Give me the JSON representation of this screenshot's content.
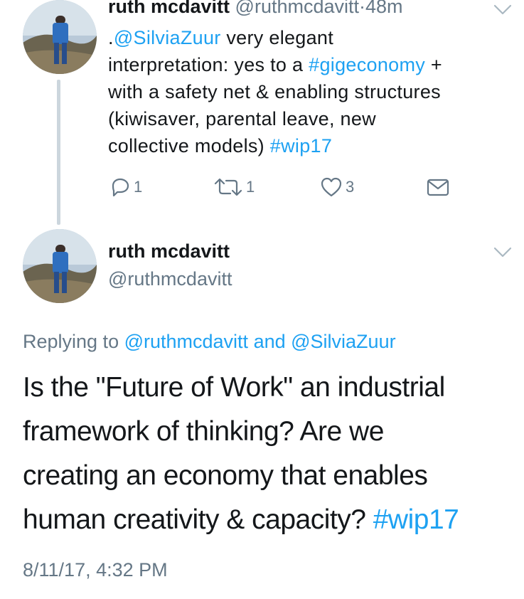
{
  "tweet1": {
    "author_name": "ruth mcdavitt",
    "author_handle": "@ruthmcdavitt",
    "separator": "·",
    "time": "48m",
    "lines": [
      [
        {
          "text": ".",
          "link": false
        },
        {
          "text": "@SilviaZuur",
          "link": true
        },
        {
          "text": " very elegant",
          "link": false
        }
      ],
      [
        {
          "text": "interpretation: yes to a ",
          "link": false
        },
        {
          "text": "#gigeconomy",
          "link": true
        },
        {
          "text": " +",
          "link": false
        }
      ],
      [
        {
          "text": "with a safety net & enabling structures",
          "link": false
        }
      ],
      [
        {
          "text": "(kiwisaver, parental leave, new",
          "link": false
        }
      ],
      [
        {
          "text": "collective models) ",
          "link": false
        },
        {
          "text": "#wip17",
          "link": true
        }
      ]
    ],
    "actions": {
      "reply_count": "1",
      "retweet_count": "1",
      "like_count": "3"
    }
  },
  "tweet2": {
    "author_name": "ruth mcdavitt",
    "author_handle": "@ruthmcdavitt",
    "replying_prefix": "Replying to ",
    "replying_user1": "@ruthmcdavitt",
    "replying_and": " and ",
    "replying_user2": "@SilviaZuur",
    "lines": [
      [
        {
          "text": "Is the \"Future of Work\" an industrial",
          "link": false
        }
      ],
      [
        {
          "text": "framework of thinking? Are we",
          "link": false
        }
      ],
      [
        {
          "text": "creating an economy that enables",
          "link": false
        }
      ],
      [
        {
          "text": "human creativity & capacity? ",
          "link": false
        },
        {
          "text": "#wip17",
          "link": true
        }
      ]
    ],
    "timestamp": "8/11/17, 4:32 PM"
  },
  "colors": {
    "link": "#1da1f2",
    "muted": "#657786",
    "text": "#14171a",
    "thread_line": "#ccd6dd"
  },
  "icons": [
    "reply-icon",
    "retweet-icon",
    "like-icon",
    "direct-message-icon",
    "chevron-down-icon"
  ]
}
